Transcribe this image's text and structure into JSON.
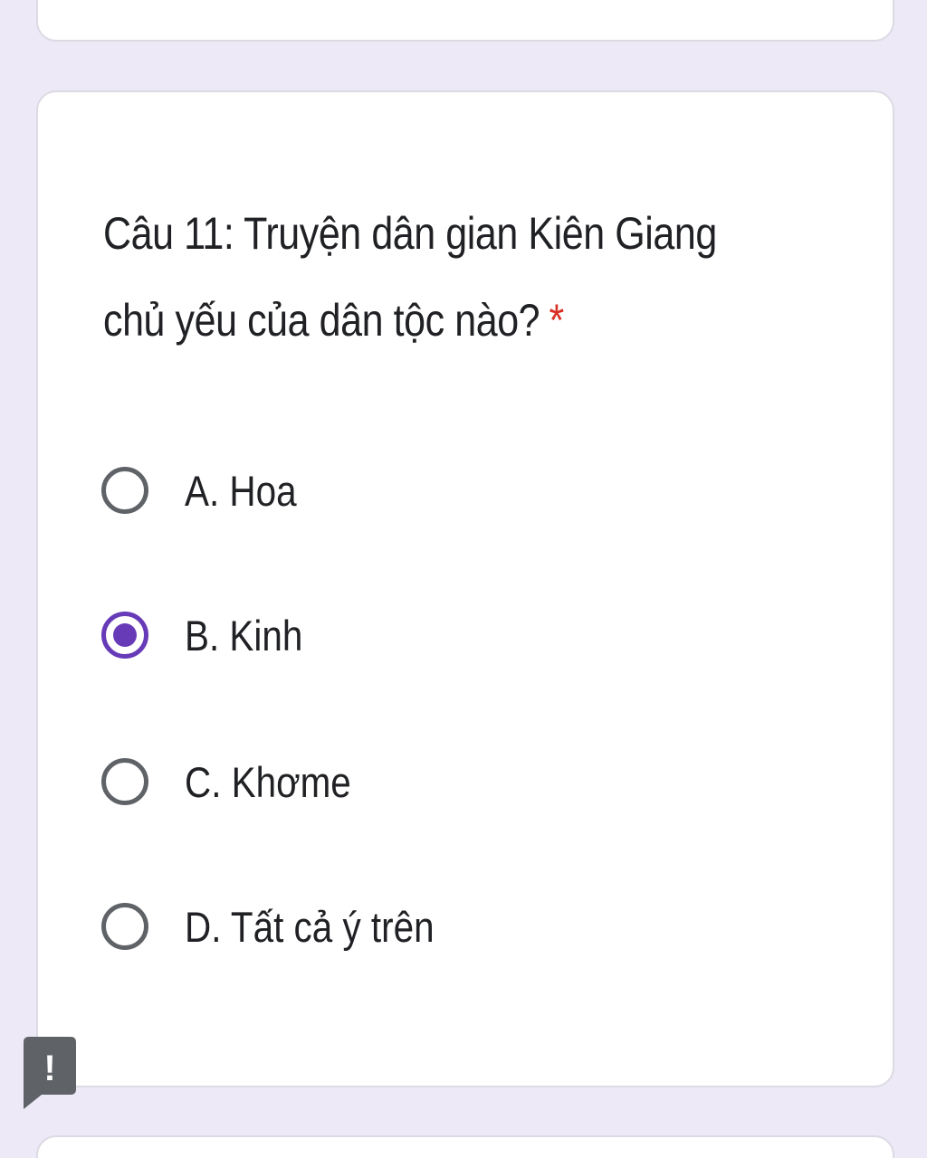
{
  "question": {
    "text": "Câu 11: Truyện dân gian Kiên Giang chủ yếu của dân tộc nào?",
    "required_mark": "*"
  },
  "options": [
    {
      "label": "A. Hoa",
      "selected": false
    },
    {
      "label": "B. Kinh",
      "selected": true
    },
    {
      "label": "C. Khơme",
      "selected": false
    },
    {
      "label": "D. Tất cả ý trên",
      "selected": false
    }
  ],
  "feedback_icon": {
    "name": "report-feedback-icon",
    "glyph": "!"
  },
  "colors": {
    "background": "#ede9f7",
    "card": "#ffffff",
    "accent": "#673ab7",
    "required": "#d93025",
    "radio_unselected": "#5f6368",
    "feedback": "#5f6368"
  }
}
